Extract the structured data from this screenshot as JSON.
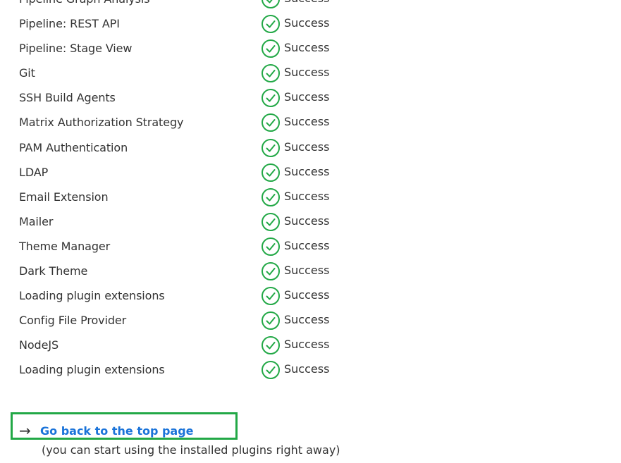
{
  "plugins": [
    {
      "name": "Pipeline Graph Analysis",
      "status": "Success"
    },
    {
      "name": "Pipeline: REST API",
      "status": "Success"
    },
    {
      "name": "Pipeline: Stage View",
      "status": "Success"
    },
    {
      "name": "Git",
      "status": "Success"
    },
    {
      "name": "SSH Build Agents",
      "status": "Success"
    },
    {
      "name": "Matrix Authorization Strategy",
      "status": "Success"
    },
    {
      "name": "PAM Authentication",
      "status": "Success"
    },
    {
      "name": "LDAP",
      "status": "Success"
    },
    {
      "name": "Email Extension",
      "status": "Success"
    },
    {
      "name": "Mailer",
      "status": "Success"
    },
    {
      "name": "Theme Manager",
      "status": "Success"
    },
    {
      "name": "Dark Theme",
      "status": "Success"
    },
    {
      "name": "Loading plugin extensions",
      "status": "Success"
    },
    {
      "name": "Config File Provider",
      "status": "Success"
    },
    {
      "name": "NodeJS",
      "status": "Success"
    },
    {
      "name": "Loading plugin extensions",
      "status": "Success"
    }
  ],
  "status_icon": "check-circle-icon",
  "colors": {
    "success": "#22a846",
    "link": "#1a73d9",
    "highlight": "#22a846"
  },
  "footer": {
    "back_link_label": "Go back to the top page",
    "arrow_icon": "→",
    "hint": "(you can start using the installed plugins right away)"
  }
}
